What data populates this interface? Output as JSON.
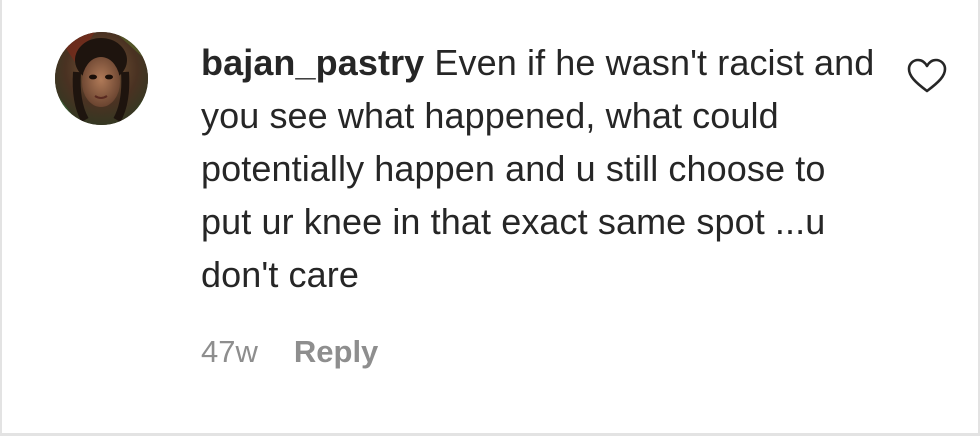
{
  "comment": {
    "username": "bajan_pastry",
    "text": "Even if he wasn't racist and you see what happened, what could potentially happen and u still choose to put ur knee in that exact same spot ...u don't care",
    "timestamp": "47w",
    "reply_label": "Reply",
    "like_icon": "heart-outline-icon",
    "avatar": "profile-photo"
  },
  "colors": {
    "text": "#262626",
    "secondary": "#8e8e8e",
    "border": "#e3e3e3"
  }
}
